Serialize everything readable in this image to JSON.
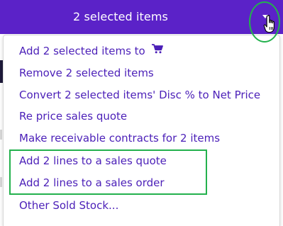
{
  "header": {
    "selection_label": "2 selected items",
    "toggle_icon": "caret-down-icon"
  },
  "menu": {
    "items": [
      {
        "label": "Add 2 selected items to",
        "icon": "cart-icon"
      },
      {
        "label": "Remove 2 selected items"
      },
      {
        "label": "Convert 2 selected items' Disc % to Net Price"
      },
      {
        "label": "Re price sales quote"
      },
      {
        "label": "Make receivable contracts for 2 items"
      },
      {
        "label": "Add 2 lines to a sales quote"
      },
      {
        "label": "Add 2 lines to a sales order"
      },
      {
        "label": "Other Sold Stock..."
      }
    ]
  },
  "colors": {
    "header_bg": "#5b22c8",
    "menu_text": "#4b1fb8",
    "highlight": "#23b14d"
  }
}
